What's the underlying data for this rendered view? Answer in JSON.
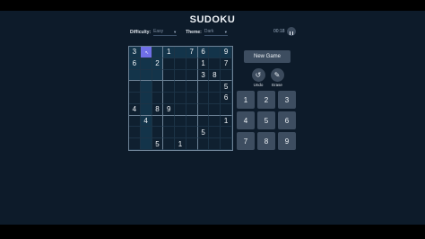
{
  "app": {
    "title": "SUDOKU",
    "difficulty_label": "Difficulty:",
    "difficulty_value": "Easy",
    "theme_label": "Theme:",
    "theme_value": "Dark",
    "timer": "00:18",
    "new_game_label": "New Game",
    "undo_label": "Undo",
    "erase_label": "Erase",
    "numpad": [
      "1",
      "2",
      "3",
      "4",
      "5",
      "6",
      "7",
      "8",
      "9"
    ]
  },
  "board": {
    "selected": [
      0,
      1
    ],
    "rows": [
      [
        "3",
        "",
        "",
        "1",
        "",
        "7",
        "6",
        "",
        "9"
      ],
      [
        "6",
        "",
        "2",
        "",
        "",
        "",
        "1",
        "",
        "7"
      ],
      [
        "",
        "",
        "",
        "",
        "",
        "",
        "3",
        "8",
        ""
      ],
      [
        "",
        "",
        "",
        "",
        "",
        "",
        "",
        "",
        "5"
      ],
      [
        "",
        "",
        "",
        "",
        "",
        "",
        "",
        "",
        "6"
      ],
      [
        "4",
        "",
        "8",
        "9",
        "",
        "",
        "",
        "",
        ""
      ],
      [
        "",
        "4",
        "",
        "",
        "",
        "",
        "",
        "",
        "1"
      ],
      [
        "",
        "",
        "",
        "",
        "",
        "",
        "5",
        "",
        ""
      ],
      [
        "",
        "",
        "5",
        "",
        "1",
        "",
        "",
        "",
        ""
      ]
    ]
  },
  "colors": {
    "background": "#0d1b2a",
    "selected_cell": "#6f6fe8",
    "highlight": "#13344a",
    "button": "#3d4d60"
  },
  "icons": {
    "undo": "undo-icon",
    "erase": "eraser-icon",
    "pause": "pause-icon",
    "cursor": "mouse-pointer-icon"
  }
}
